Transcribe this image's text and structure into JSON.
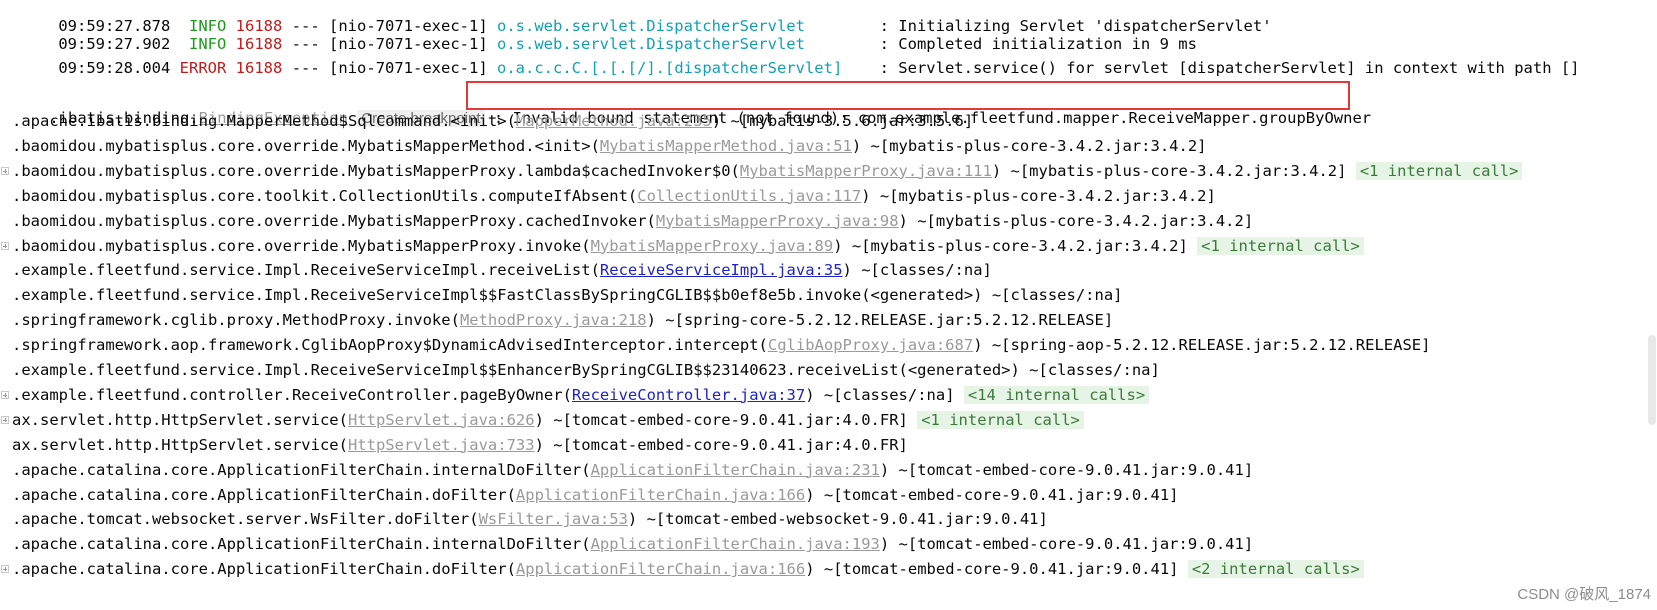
{
  "log_lines": [
    {
      "time": "09:59:27.878",
      "level": "INFO",
      "pid": "16188",
      "sep": "---",
      "thread": "[nio-7071-exec-1]",
      "logger": "o.s.web.servlet.DispatcherServlet",
      "message": "Initializing Servlet 'dispatcherServlet'"
    },
    {
      "time": "09:59:27.902",
      "level": "INFO",
      "pid": "16188",
      "sep": "---",
      "thread": "[nio-7071-exec-1]",
      "logger": "o.s.web.servlet.DispatcherServlet",
      "message": "Completed initialization in 9 ms"
    },
    {
      "time": "09:59:28.004",
      "level": "ERROR",
      "pid": "16188",
      "sep": "---",
      "thread": "[nio-7071-exec-1]",
      "logger": "o.a.c.c.C.[.[.[/].[dispatcherServlet]",
      "message": "Servlet.service() for servlet [dispatcherServlet] in context with path []"
    }
  ],
  "exception": {
    "prefix": ".ibatis.binding.",
    "class_link": "BindingException",
    "breakpoint_label": "Create breakpoint",
    "colon": ":",
    "message": "Invalid bound statement (not found): com.example.fleetfund.mapper.ReceiveMapper.groupByOwner"
  },
  "stack": [
    {
      "pre": ".apache.ibatis.binding.MapperMethod$SqlCommand.<init>(",
      "link": "MapperMethod.java:235",
      "link_style": "gray",
      "post": ") ~[mybatis-3.5.6.jar:3.5.6]",
      "internal": "",
      "fold": false
    },
    {
      "pre": ".baomidou.mybatisplus.core.override.MybatisMapperMethod.<init>(",
      "link": "MybatisMapperMethod.java:51",
      "link_style": "gray",
      "post": ") ~[mybatis-plus-core-3.4.2.jar:3.4.2]",
      "internal": "",
      "fold": false
    },
    {
      "pre": ".baomidou.mybatisplus.core.override.MybatisMapperProxy.lambda$cachedInvoker$0(",
      "link": "MybatisMapperProxy.java:111",
      "link_style": "gray",
      "post": ") ~[mybatis-plus-core-3.4.2.jar:3.4.2]",
      "internal": "<1 internal call>",
      "fold": true
    },
    {
      "pre": ".baomidou.mybatisplus.core.toolkit.CollectionUtils.computeIfAbsent(",
      "link": "CollectionUtils.java:117",
      "link_style": "gray",
      "post": ") ~[mybatis-plus-core-3.4.2.jar:3.4.2]",
      "internal": "",
      "fold": false
    },
    {
      "pre": ".baomidou.mybatisplus.core.override.MybatisMapperProxy.cachedInvoker(",
      "link": "MybatisMapperProxy.java:98",
      "link_style": "gray",
      "post": ") ~[mybatis-plus-core-3.4.2.jar:3.4.2]",
      "internal": "",
      "fold": false
    },
    {
      "pre": ".baomidou.mybatisplus.core.override.MybatisMapperProxy.invoke(",
      "link": "MybatisMapperProxy.java:89",
      "link_style": "gray",
      "post": ") ~[mybatis-plus-core-3.4.2.jar:3.4.2]",
      "internal": "<1 internal call>",
      "fold": true
    },
    {
      "pre": ".example.fleetfund.service.Impl.ReceiveServiceImpl.receiveList(",
      "link": "ReceiveServiceImpl.java:35",
      "link_style": "blue",
      "post": ") ~[classes/:na]",
      "internal": "",
      "fold": false
    },
    {
      "pre": ".example.fleetfund.service.Impl.ReceiveServiceImpl$$FastClassBySpringCGLIB$$b0ef8e5b.invoke(<generated>) ~[classes/:na]",
      "link": "",
      "link_style": "",
      "post": "",
      "internal": "",
      "fold": false
    },
    {
      "pre": ".springframework.cglib.proxy.MethodProxy.invoke(",
      "link": "MethodProxy.java:218",
      "link_style": "gray",
      "post": ") ~[spring-core-5.2.12.RELEASE.jar:5.2.12.RELEASE]",
      "internal": "",
      "fold": false
    },
    {
      "pre": ".springframework.aop.framework.CglibAopProxy$DynamicAdvisedInterceptor.intercept(",
      "link": "CglibAopProxy.java:687",
      "link_style": "gray",
      "post": ") ~[spring-aop-5.2.12.RELEASE.jar:5.2.12.RELEASE]",
      "internal": "",
      "fold": false
    },
    {
      "pre": ".example.fleetfund.service.Impl.ReceiveServiceImpl$$EnhancerBySpringCGLIB$$23140623.receiveList(<generated>) ~[classes/:na]",
      "link": "",
      "link_style": "",
      "post": "",
      "internal": "",
      "fold": false
    },
    {
      "pre": ".example.fleetfund.controller.ReceiveController.pageByOwner(",
      "link": "ReceiveController.java:37",
      "link_style": "blue",
      "post": ") ~[classes/:na]",
      "internal": "<14 internal calls>",
      "fold": true
    },
    {
      "pre": "ax.servlet.http.HttpServlet.service(",
      "link": "HttpServlet.java:626",
      "link_style": "gray",
      "post": ") ~[tomcat-embed-core-9.0.41.jar:4.0.FR]",
      "internal": "<1 internal call>",
      "fold": true
    },
    {
      "pre": "ax.servlet.http.HttpServlet.service(",
      "link": "HttpServlet.java:733",
      "link_style": "gray",
      "post": ") ~[tomcat-embed-core-9.0.41.jar:4.0.FR]",
      "internal": "",
      "fold": false
    },
    {
      "pre": ".apache.catalina.core.ApplicationFilterChain.internalDoFilter(",
      "link": "ApplicationFilterChain.java:231",
      "link_style": "gray",
      "post": ") ~[tomcat-embed-core-9.0.41.jar:9.0.41]",
      "internal": "",
      "fold": false
    },
    {
      "pre": ".apache.catalina.core.ApplicationFilterChain.doFilter(",
      "link": "ApplicationFilterChain.java:166",
      "link_style": "gray",
      "post": ") ~[tomcat-embed-core-9.0.41.jar:9.0.41]",
      "internal": "",
      "fold": false
    },
    {
      "pre": ".apache.tomcat.websocket.server.WsFilter.doFilter(",
      "link": "WsFilter.java:53",
      "link_style": "gray",
      "post": ") ~[tomcat-embed-websocket-9.0.41.jar:9.0.41]",
      "internal": "",
      "fold": false
    },
    {
      "pre": ".apache.catalina.core.ApplicationFilterChain.internalDoFilter(",
      "link": "ApplicationFilterChain.java:193",
      "link_style": "gray",
      "post": ") ~[tomcat-embed-core-9.0.41.jar:9.0.41]",
      "internal": "",
      "fold": false
    },
    {
      "pre": ".apache.catalina.core.ApplicationFilterChain.doFilter(",
      "link": "ApplicationFilterChain.java:166",
      "link_style": "gray",
      "post": ") ~[tomcat-embed-core-9.0.41.jar:9.0.41]",
      "internal": "<2 internal calls>",
      "fold": true
    }
  ],
  "watermark": "CSDN @破风_1874",
  "colors": {
    "info": "#1a9c1a",
    "error": "#c41a1a",
    "logger": "#10a0b8",
    "link": "#1e22cc",
    "highlight": "#e53935"
  }
}
